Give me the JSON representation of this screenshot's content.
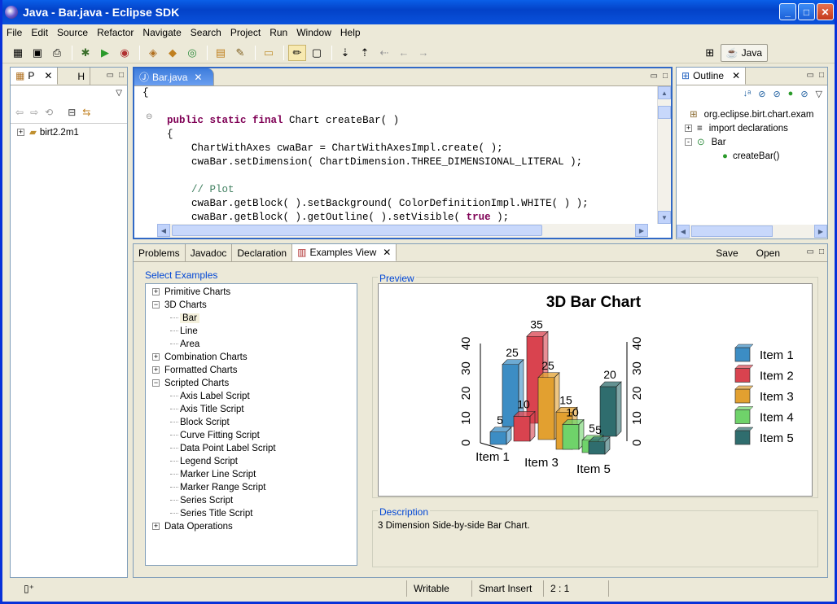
{
  "window": {
    "title": "Java - Bar.java - Eclipse SDK"
  },
  "menu": [
    "File",
    "Edit",
    "Source",
    "Refactor",
    "Navigate",
    "Search",
    "Project",
    "Run",
    "Window",
    "Help"
  ],
  "perspective": {
    "label": "Java"
  },
  "left_view": {
    "tabs": [
      "P",
      "H"
    ],
    "tree": [
      {
        "label": "birt2.2m1"
      }
    ]
  },
  "editor": {
    "tab": "Bar.java",
    "lines": [
      {
        "segs": [
          {
            "t": "{",
            "c": ""
          }
        ]
      },
      {
        "segs": [
          {
            "t": "",
            "c": ""
          }
        ]
      },
      {
        "segs": [
          {
            "t": "    ",
            "c": ""
          },
          {
            "t": "public static final",
            "c": "kw"
          },
          {
            "t": " Chart createBar( )",
            "c": ""
          }
        ]
      },
      {
        "segs": [
          {
            "t": "    {",
            "c": ""
          }
        ]
      },
      {
        "segs": [
          {
            "t": "        ChartWithAxes cwaBar = ChartWithAxesImpl.create( );",
            "c": ""
          }
        ]
      },
      {
        "segs": [
          {
            "t": "        cwaBar.setDimension( ChartDimension.THREE_DIMENSIONAL_LITERAL );",
            "c": ""
          }
        ]
      },
      {
        "segs": [
          {
            "t": "",
            "c": ""
          }
        ]
      },
      {
        "segs": [
          {
            "t": "        // Plot",
            "c": "cm"
          }
        ]
      },
      {
        "segs": [
          {
            "t": "        cwaBar.getBlock( ).setBackground( ColorDefinitionImpl.WHITE( ) );",
            "c": ""
          }
        ]
      },
      {
        "segs": [
          {
            "t": "        cwaBar.getBlock( ).getOutline( ).setVisible( ",
            "c": ""
          },
          {
            "t": "true",
            "c": "kw"
          },
          {
            "t": " );",
            "c": ""
          }
        ]
      }
    ]
  },
  "outline": {
    "tab": "Outline",
    "items": [
      {
        "label": "org.eclipse.birt.chart.exam",
        "indent": 0
      },
      {
        "label": "import declarations",
        "indent": 0
      },
      {
        "label": "Bar",
        "indent": 0
      },
      {
        "label": "createBar()",
        "indent": 1
      }
    ]
  },
  "bottom": {
    "tabs": [
      "Problems",
      "Javadoc",
      "Declaration",
      "Examples View"
    ],
    "actions": {
      "save": "Save",
      "open": "Open"
    },
    "select_label": "Select Examples",
    "tree": [
      {
        "label": "Primitive Charts",
        "level": 0,
        "exp": "+"
      },
      {
        "label": "3D Charts",
        "level": 0,
        "exp": "-"
      },
      {
        "label": "Bar",
        "level": 1,
        "sel": true
      },
      {
        "label": "Line",
        "level": 1
      },
      {
        "label": "Area",
        "level": 1
      },
      {
        "label": "Combination Charts",
        "level": 0,
        "exp": "+"
      },
      {
        "label": "Formatted Charts",
        "level": 0,
        "exp": "+"
      },
      {
        "label": "Scripted Charts",
        "level": 0,
        "exp": "-"
      },
      {
        "label": "Axis Label Script",
        "level": 1
      },
      {
        "label": "Axis Title Script",
        "level": 1
      },
      {
        "label": "Block Script",
        "level": 1
      },
      {
        "label": "Curve Fitting Script",
        "level": 1
      },
      {
        "label": "Data Point Label Script",
        "level": 1
      },
      {
        "label": "Legend Script",
        "level": 1
      },
      {
        "label": "Marker Line Script",
        "level": 1
      },
      {
        "label": "Marker Range Script",
        "level": 1
      },
      {
        "label": "Series Script",
        "level": 1
      },
      {
        "label": "Series Title Script",
        "level": 1
      },
      {
        "label": "Data Operations",
        "level": 0,
        "exp": "+"
      }
    ],
    "preview_label": "Preview",
    "description_label": "Description",
    "description": "3 Dimension Side-by-side Bar Chart."
  },
  "chart_data": {
    "type": "bar",
    "title": "3D Bar Chart",
    "categories": [
      "Item 1",
      "Item 2",
      "Item 3",
      "Item 4",
      "Item 5"
    ],
    "x_tick_labels": [
      "Item 1",
      "Item 3",
      "Item 5"
    ],
    "series": [
      {
        "values": [
          5,
          25
        ]
      },
      {
        "values": [
          10,
          35
        ]
      },
      {
        "values": [
          25,
          15
        ]
      },
      {
        "values": [
          10,
          5
        ]
      },
      {
        "values": [
          5,
          20
        ]
      }
    ],
    "data_labels": [
      "5",
      "25",
      "10",
      "35",
      "25",
      "5",
      "10",
      "5",
      "5",
      "20"
    ],
    "colors": [
      "#3c8dc4",
      "#d9434f",
      "#e2a030",
      "#6fd36a",
      "#2f6d6e"
    ],
    "ylim": [
      0,
      40
    ],
    "yticks": [
      "0",
      "10",
      "20",
      "30",
      "40"
    ],
    "legend": [
      "Item 1",
      "Item 2",
      "Item 3",
      "Item 4",
      "Item 5"
    ],
    "legend_position": "right"
  },
  "status": {
    "mode": "Writable",
    "insert": "Smart Insert",
    "position": "2 : 1"
  }
}
